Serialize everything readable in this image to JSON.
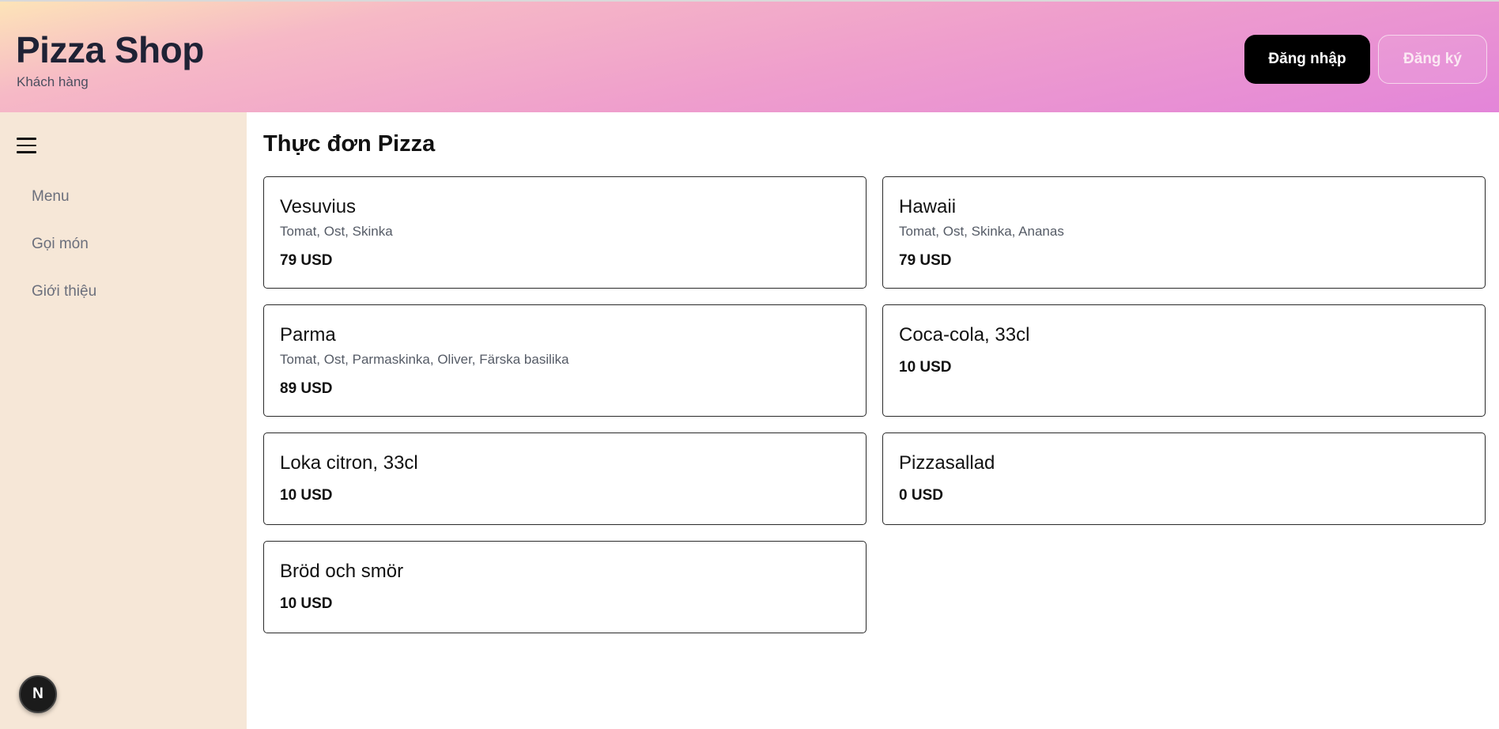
{
  "header": {
    "title": "Pizza Shop",
    "subtitle": "Khách hàng",
    "login_label": "Đăng nhập",
    "register_label": "Đăng ký"
  },
  "sidebar": {
    "menu_icon": "hamburger-menu-icon",
    "items": [
      {
        "label": "Menu"
      },
      {
        "label": "Gọi món"
      },
      {
        "label": "Giới thiệu"
      }
    ],
    "badge_letter": "N"
  },
  "main": {
    "title": "Thực đơn Pizza",
    "products": [
      {
        "name": "Vesuvius",
        "description": "Tomat, Ost, Skinka",
        "price": "79 USD"
      },
      {
        "name": "Hawaii",
        "description": "Tomat, Ost, Skinka, Ananas",
        "price": "79 USD"
      },
      {
        "name": "Parma",
        "description": "Tomat, Ost, Parmaskinka, Oliver, Färska basilika",
        "price": "89 USD"
      },
      {
        "name": "Coca-cola, 33cl",
        "description": "",
        "price": "10 USD"
      },
      {
        "name": "Loka citron, 33cl",
        "description": "",
        "price": "10 USD"
      },
      {
        "name": "Pizzasallad",
        "description": "",
        "price": "0 USD"
      },
      {
        "name": "Bröd och smör",
        "description": "",
        "price": "10 USD"
      }
    ]
  },
  "colors": {
    "header_gradient": [
      "#fde4b8",
      "#f6b9c6",
      "#ef9fcc",
      "#e385d9"
    ],
    "sidebar_bg": "#f6e7d7",
    "primary_button": "#000000"
  }
}
